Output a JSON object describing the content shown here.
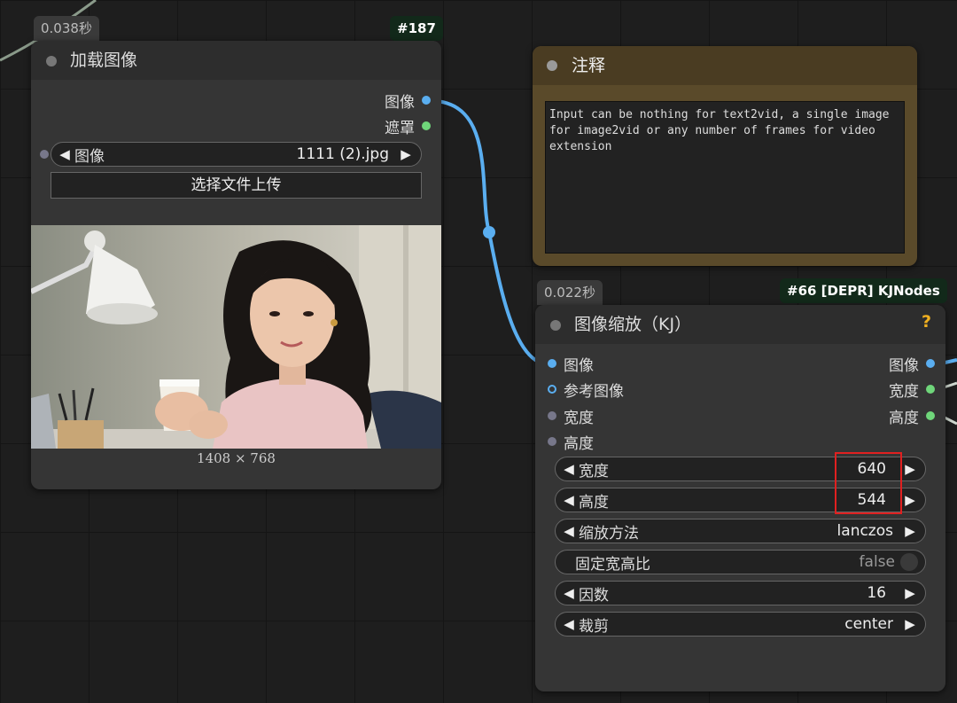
{
  "load_node": {
    "time": "0.038秒",
    "id": "#187",
    "title": "加载图像",
    "outputs": [
      "图像",
      "遮罩"
    ],
    "image_widget": {
      "label": "图像",
      "value": "1111 (2).jpg"
    },
    "upload_label": "选择文件上传",
    "preview_caption": "1408 × 768"
  },
  "note_node": {
    "title": "注释",
    "text": "Input can be nothing for text2vid, a single image for image2vid or any number of frames for video extension"
  },
  "resize_node": {
    "time": "0.022秒",
    "id": "#66 [DEPR] KJNodes",
    "title": "图像缩放（KJ）",
    "help": "?",
    "inputs": [
      "图像",
      "参考图像",
      "宽度",
      "高度"
    ],
    "outputs": [
      "图像",
      "宽度",
      "高度"
    ],
    "widgets": {
      "width": {
        "label": "宽度",
        "value": "640"
      },
      "height": {
        "label": "高度",
        "value": "544"
      },
      "method": {
        "label": "缩放方法",
        "value": "lanczos"
      },
      "keep_ratio": {
        "label": "固定宽高比",
        "value": "false"
      },
      "factor": {
        "label": "因数",
        "value": "16"
      },
      "crop": {
        "label": "裁剪",
        "value": "center"
      }
    }
  },
  "colors": {
    "image_link": "#5aaef0",
    "int_slot": "#6fd67a",
    "highlight": "#e02020"
  }
}
